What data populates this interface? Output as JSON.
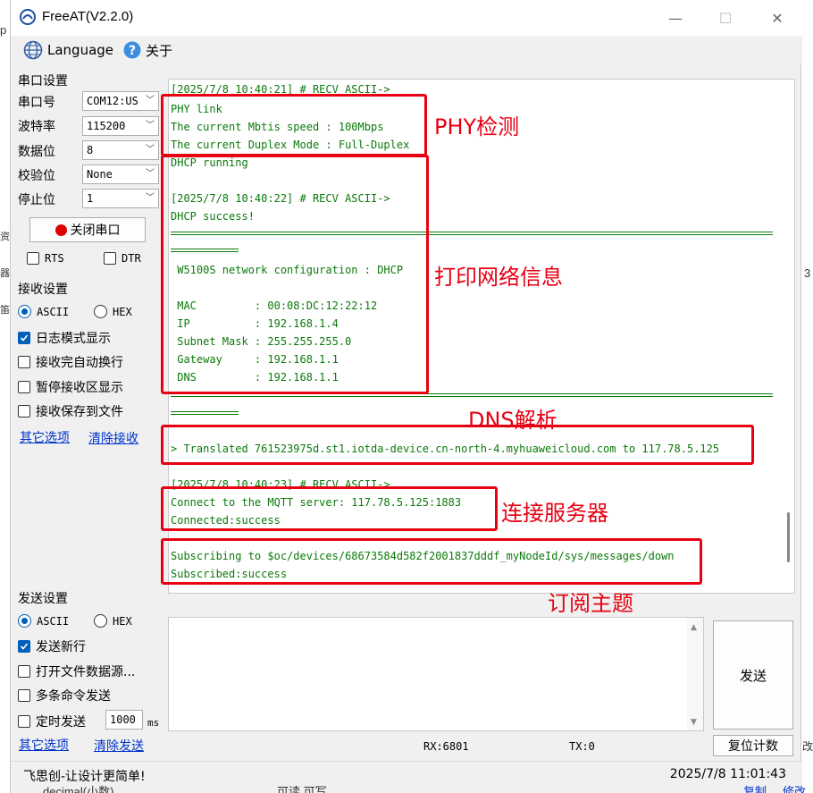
{
  "window": {
    "title": "FreeAT(V2.2.0)",
    "min": "—",
    "max": "☐",
    "close": "✕"
  },
  "menu": {
    "language": "Language",
    "about": "关于"
  },
  "serial": {
    "group": "串口设置",
    "port_label": "串口号",
    "port_value": "COM12:US",
    "baud_label": "波特率",
    "baud_value": "115200",
    "data_label": "数据位",
    "data_value": "8",
    "parity_label": "校验位",
    "parity_value": "None",
    "stop_label": "停止位",
    "stop_value": "1",
    "close_btn": "关闭串口",
    "rts": "RTS",
    "dtr": "DTR"
  },
  "receive": {
    "group": "接收设置",
    "ascii": "ASCII",
    "hex": "HEX",
    "log_mode": "日志模式显示",
    "auto_newline": "接收完自动换行",
    "pause": "暂停接收区显示",
    "save_file": "接收保存到文件",
    "other_options": "其它选项",
    "clear_recv": "清除接收"
  },
  "send": {
    "group": "发送设置",
    "ascii": "ASCII",
    "hex": "HEX",
    "newline": "发送新行",
    "open_file": "打开文件数据源...",
    "multi_cmd": "多条命令发送",
    "timed": "定时发送",
    "interval": "1000",
    "unit": "ms",
    "other_options": "其它选项",
    "clear_send": "清除发送",
    "send_btn": "发送",
    "reset_btn": "复位计数"
  },
  "log": {
    "l0": "[2025/7/8 10:40:21] # RECV ASCII->",
    "l1": "PHY link",
    "l2": "The current Mbtis speed : 100Mbps",
    "l3": "The current Duplex Mode : Full-Duplex",
    "l4": "DHCP running",
    "l5": "[2025/7/8 10:40:22] # RECV ASCII->",
    "l6": "DHCP success!",
    "l7": " W5100S network configuration : DHCP",
    "l8": " MAC         : 00:08:DC:12:22:12",
    "l9": " IP          : 192.168.1.4",
    "l10": " Subnet Mask : 255.255.255.0",
    "l11": " Gateway     : 192.168.1.1",
    "l12": " DNS         : 192.168.1.1",
    "l13": "> Translated 761523975d.st1.iotda-device.cn-north-4.myhuaweicloud.com to 117.78.5.125",
    "l14": "[2025/7/8 10:40:23] # RECV ASCII->",
    "l15": "Connect to the MQTT server: 117.78.5.125:1883",
    "l16": "Connected:success",
    "l17": "Subscribing to $oc/devices/68673584d582f2001837dddf_myNodeId/sys/messages/down",
    "l18": "Subscribed:success"
  },
  "annotations": {
    "phy": "PHY检测",
    "net": "打印网络信息",
    "dns": "DNS解析",
    "mqtt": "连接服务器",
    "sub": "订阅主题"
  },
  "status": {
    "rx": "RX:6801",
    "tx": "TX:0"
  },
  "footer": {
    "slogan": "飞思创-让设计更简单!",
    "datetime": "2025/7/8 11:01:43"
  },
  "background": {
    "b1": "p",
    "b2": "资",
    "b3": "器",
    "b4": "笛",
    "b5": "3",
    "b6": "decimal(小数)",
    "b7": "可读,可写",
    "b8": "复制",
    "b9": "修改",
    "b10": "改"
  },
  "colors": {
    "log_text": "#0a7a0a",
    "annotation": "#e60012",
    "accent": "#005fb8"
  }
}
